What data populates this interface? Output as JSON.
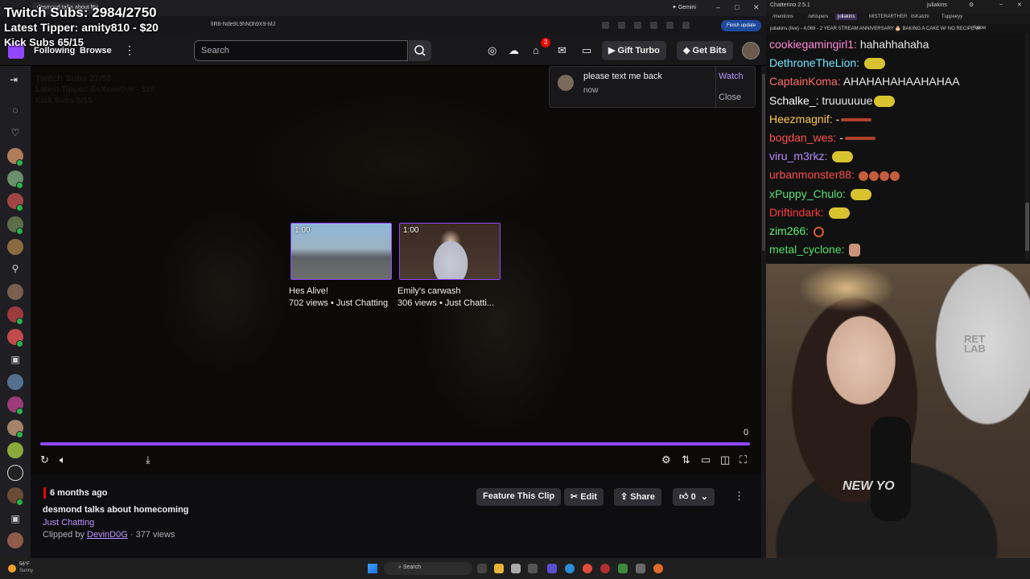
{
  "browser": {
    "tab_title": "desmond talks about homeco",
    "url_fragment": "lIR8-Nde9L9hN0h9X9-MJ",
    "gemini_label": "Gemini",
    "finish_update_label": "Finish update"
  },
  "overlay": {
    "twitch_subs": "Twitch Subs: 2984/2750",
    "latest_tipper": "Latest Tipper: amity810 - $20",
    "kick_subs": "Kick Subs 65/15",
    "ghost_twitch_subs": "Twitch Subs 27/50",
    "ghost_latest_tipper": "Latest Tipper: SoXenstive - $28",
    "ghost_kick_subs": "Kick Subs 5/15"
  },
  "nav": {
    "following": "Following",
    "browse": "Browse",
    "search_placeholder": "Search",
    "notification_count": "3",
    "gift_turbo": "Gift Turbo",
    "get_bits": "Get Bits"
  },
  "notification": {
    "message": "please text me back",
    "time": "now",
    "watch": "Watch",
    "close": "Close"
  },
  "recommendations": [
    {
      "duration": "1:00",
      "title": "Hes Alive!",
      "meta": "702 views • Just Chatting"
    },
    {
      "duration": "1:00",
      "title": "Emily's carwash",
      "meta": "306 views • Just Chatti..."
    }
  ],
  "player": {
    "time_counter": "0",
    "progress_fraction": 1.0
  },
  "clip": {
    "age": "6 months ago",
    "title": "desmond talks about homecoming",
    "category": "Just Chatting",
    "clipped_by_prefix": "Clipped by",
    "clipper": "DevinD0G",
    "views_suffix": " · 377 views",
    "feature_label": "Feature This Clip",
    "edit_label": "Edit",
    "share_label": "Share",
    "like_count": "0"
  },
  "chatterino": {
    "window_title": "Chatterino 2.5.1",
    "account": "juliakins",
    "tabs": [
      "/mentions",
      "/whispers",
      "juliakins",
      "MISTERARTHER",
      "itsKatchi",
      "Tuppeeyy"
    ],
    "header": "juliakins (live) - 4,069 - 2 YEAR STREAM ANNIVERSARY 🎂 BAKING A CAKE W/ NO RECIPE w/",
    "follow_label": "follow",
    "messages": [
      {
        "name": "cookiegamingirl1:",
        "text": "hahahhahaha",
        "color": "#ff8ad8",
        "emote": ""
      },
      {
        "name": "DethroneTheLion:",
        "text": "",
        "color": "#6fe3ff",
        "emote": "blob"
      },
      {
        "name": "CaptainKoma:",
        "text": "AHAHAHAHAAHAHAA",
        "color": "#ff6a6a",
        "emote": ""
      },
      {
        "name": "Schalke_:",
        "text": "truuuuuue",
        "color": "#ffffff",
        "emote": "blob"
      },
      {
        "name": "Heezmagnif:",
        "text": "-",
        "color": "#ffc94a",
        "emote": "line"
      },
      {
        "name": "bogdan_wes:",
        "text": "-",
        "color": "#ff5252",
        "emote": "line"
      },
      {
        "name": "viru_m3rkz:",
        "text": "",
        "color": "#b78cff",
        "emote": "blob"
      },
      {
        "name": "urbanmonster88:",
        "text": "",
        "color": "#ff4d4d",
        "emote": "small"
      },
      {
        "name": "xPuppy_Chulo:",
        "text": "",
        "color": "#58e07a",
        "emote": "blob"
      },
      {
        "name": "Driftindark:",
        "text": "",
        "color": "#ff3b3b",
        "emote": "blob"
      },
      {
        "name": "zim266:",
        "text": "",
        "color": "#5cf07a",
        "emote": "ring"
      },
      {
        "name": "metal_cyclone:",
        "text": "",
        "color": "#54e06a",
        "emote": "hand"
      }
    ]
  },
  "webcam": {
    "shirt_text": "NEW YO",
    "chair_text": "RET\nLAB"
  },
  "taskbar": {
    "temperature": "56°F",
    "weather": "Sunny",
    "search_label": "Search"
  }
}
